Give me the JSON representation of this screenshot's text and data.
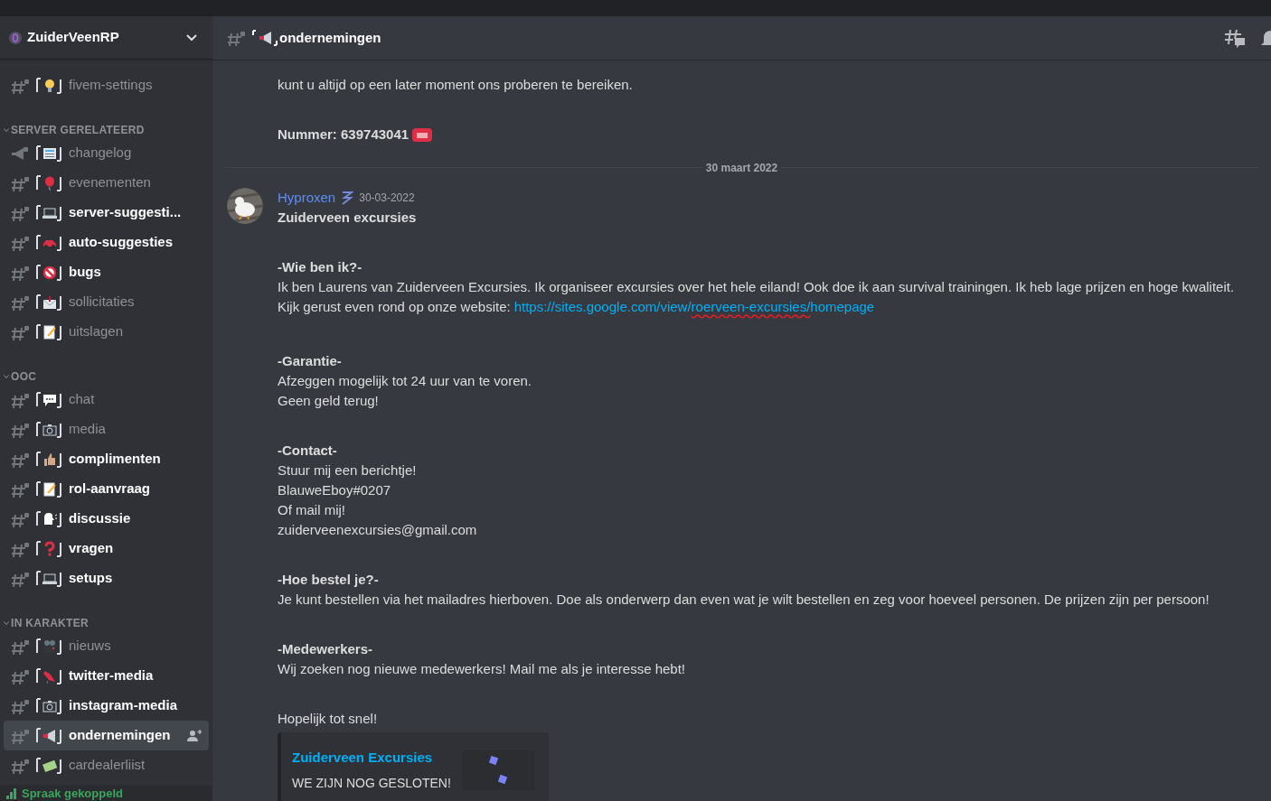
{
  "server": {
    "name": "ZuiderVeenRP"
  },
  "sidebar": {
    "groups": [
      {
        "items": [
          {
            "name": "fivem-settings",
            "kind": "text",
            "unread": false,
            "selected": false,
            "invite": false
          }
        ]
      },
      {
        "category": "SERVER GERELATEERD",
        "items": [
          {
            "name": "changelog",
            "kind": "announcement",
            "unread": false,
            "selected": false,
            "invite": false
          },
          {
            "name": "evenementen",
            "kind": "text",
            "unread": false,
            "selected": false,
            "invite": false
          },
          {
            "name": "server-suggesti...",
            "kind": "text",
            "unread": true,
            "selected": false,
            "invite": false
          },
          {
            "name": "auto-suggesties",
            "kind": "text",
            "unread": true,
            "selected": false,
            "invite": false
          },
          {
            "name": "bugs",
            "kind": "text",
            "unread": true,
            "selected": false,
            "invite": false
          },
          {
            "name": "sollicitaties",
            "kind": "text",
            "unread": false,
            "selected": false,
            "invite": false
          },
          {
            "name": "uitslagen",
            "kind": "text",
            "unread": false,
            "selected": false,
            "invite": false
          }
        ]
      },
      {
        "category": "OOC",
        "items": [
          {
            "name": "chat",
            "kind": "text",
            "unread": false,
            "selected": false,
            "invite": false
          },
          {
            "name": "media",
            "kind": "text",
            "unread": false,
            "selected": false,
            "invite": false
          },
          {
            "name": "complimenten",
            "kind": "text",
            "unread": true,
            "selected": false,
            "invite": false
          },
          {
            "name": "rol-aanvraag",
            "kind": "text",
            "unread": true,
            "selected": false,
            "invite": false
          },
          {
            "name": "discussie",
            "kind": "text",
            "unread": true,
            "selected": false,
            "invite": false
          },
          {
            "name": "vragen",
            "kind": "text",
            "unread": true,
            "selected": false,
            "invite": false
          },
          {
            "name": "setups",
            "kind": "text",
            "unread": true,
            "selected": false,
            "invite": false
          }
        ]
      },
      {
        "category": "IN KARAKTER",
        "items": [
          {
            "name": "nieuws",
            "kind": "text",
            "unread": false,
            "selected": false,
            "invite": false
          },
          {
            "name": "twitter-media",
            "kind": "text",
            "unread": true,
            "selected": false,
            "invite": false
          },
          {
            "name": "instagram-media",
            "kind": "text",
            "unread": true,
            "selected": false,
            "invite": false
          },
          {
            "name": "ondernemingen",
            "kind": "text",
            "unread": true,
            "selected": true,
            "invite": true
          },
          {
            "name": "cardealerliist",
            "kind": "text",
            "unread": false,
            "selected": false,
            "invite": false
          }
        ]
      }
    ]
  },
  "voice": {
    "status": "Spraak gekoppeld"
  },
  "header": {
    "channel": "ondernemingen"
  },
  "messages": [
    {
      "kind": "continuation",
      "sections": [
        {
          "text": "kunt u altijd op een later moment ons proberen te bereiken."
        },
        {
          "text": "**Nummer: 639743041**",
          "kind": "with-icon"
        }
      ]
    },
    {
      "kind": "divider",
      "label": "30 maart 2022"
    },
    {
      "kind": "message",
      "author": "Hyproxen",
      "time": "30-03-2022",
      "sections": [
        {
          "text": "**Zuiderveen excursies**"
        },
        {
          "text": "**-Wie ben ik?-**\nIk ben Laurens van Zuiderveen Excursies. Ik organiseer excursies over het hele eiland! Ook doe ik aan survival trainingen. Ik heb lage prijzen en hoge kwaliteit.",
          "lead": "Kijk gerust even rond op onze website:",
          "link": [
            {
              "text": "https://sites.google.com/view/",
              "misspelled": false
            },
            {
              "text": "roerveen-excursies/",
              "misspelled": true
            },
            {
              "text": "homepage",
              "misspelled": false
            }
          ]
        },
        {
          "text": "**-Garantie-**\nAfzeggen mogelijk tot 24 uur van te voren.\nGeen geld terug!"
        },
        {
          "text": "**-Contact-**\nStuur mij een berichtje!\nBlauweEboy#0207\nOf mail mij!\nzuiderveenexcursies@gmail.com"
        },
        {
          "text": "**-Hoe bestel je?-**\nJe kunt bestellen via het mailadres hierboven. Doe als onderwerp dan even wat je wilt bestellen en zeg voor hoeveel personen. De prijzen zijn per persoon!"
        },
        {
          "text": "**-Medewerkers-**\nWij zoeken nog nieuwe medewerkers! Mail me als je interesse hebt!"
        },
        {
          "text": "Hopelijk tot snel!"
        }
      ],
      "embed": {
        "title": "Zuiderveen Excursies",
        "description": "WE ZIJN NOG GESLOTEN!"
      }
    }
  ]
}
